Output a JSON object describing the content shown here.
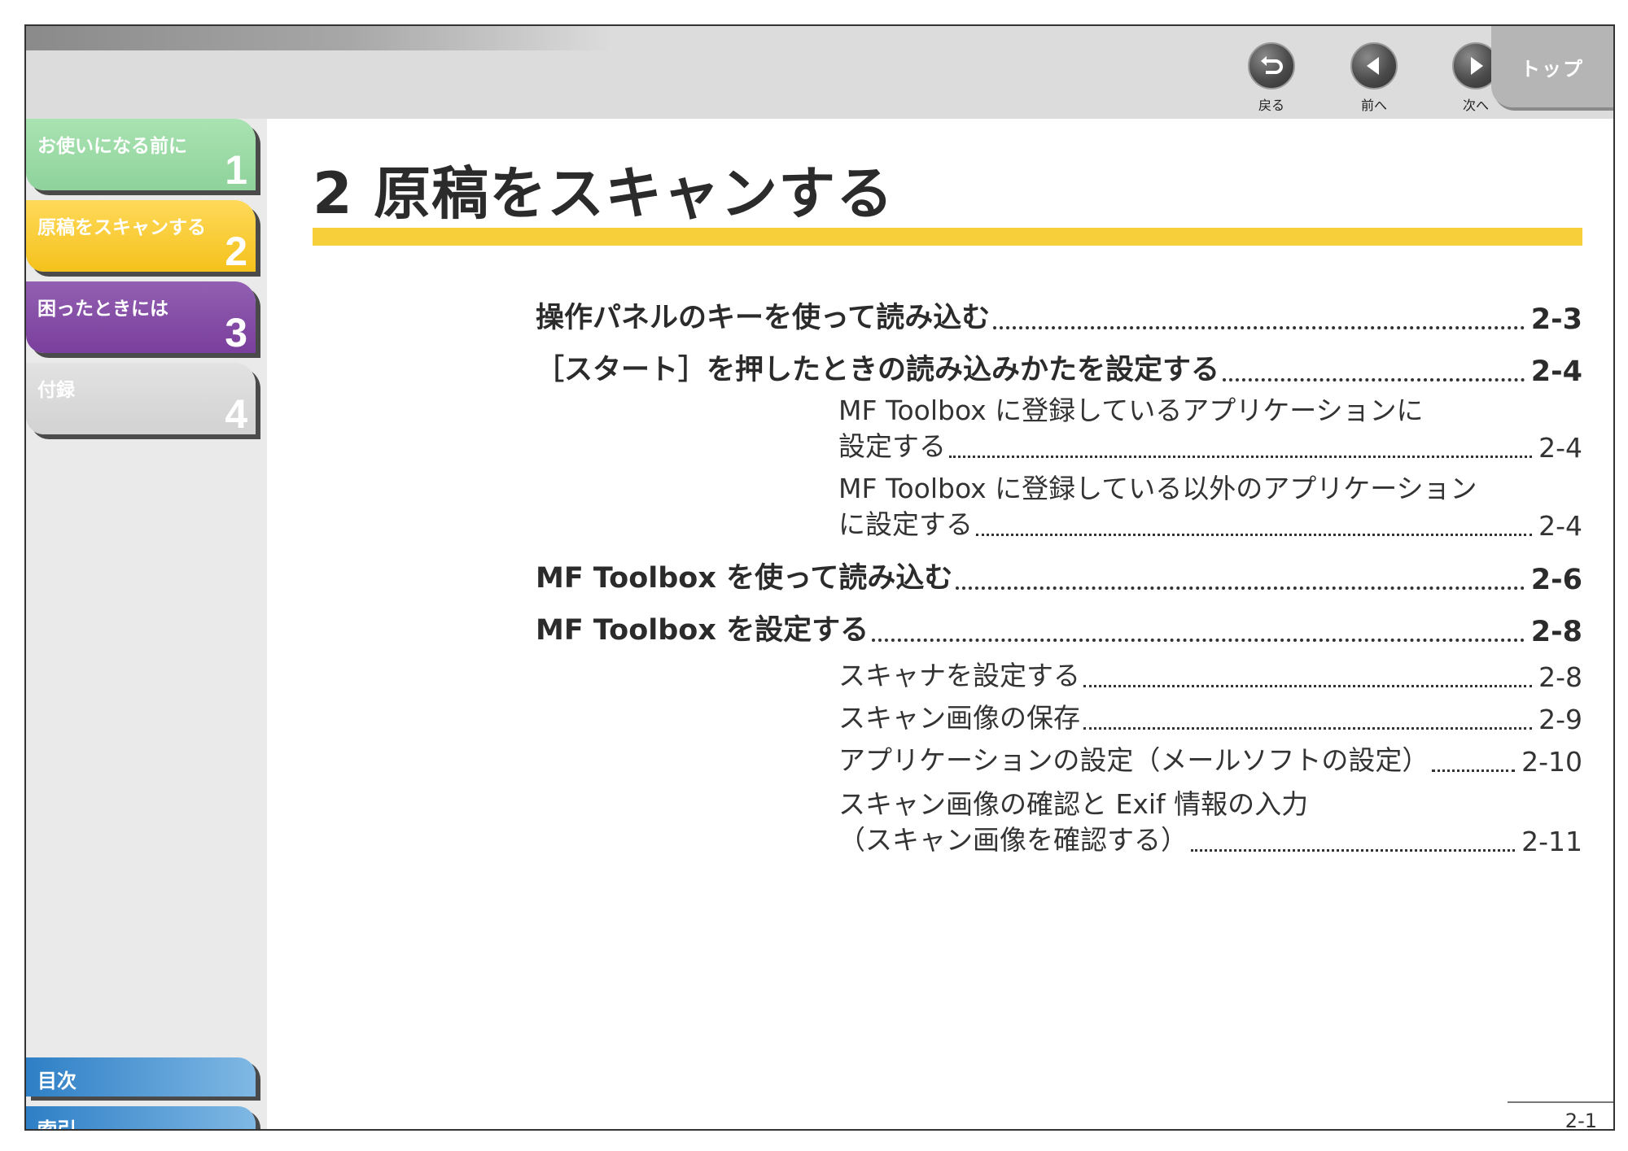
{
  "nav": {
    "back_label": "戻る",
    "prev_label": "前へ",
    "next_label": "次へ",
    "top_label": "トップ"
  },
  "sidebar": {
    "chapters": [
      {
        "title": "お使いになる前に",
        "num": "1",
        "color": "#8fd29b"
      },
      {
        "title": "原稿をスキャンする",
        "num": "2",
        "color": "#f4c21c"
      },
      {
        "title": "困ったときには",
        "num": "3",
        "color": "#7a3e9c"
      },
      {
        "title": "付録",
        "num": "4",
        "color": "#d2d2d2"
      }
    ],
    "contents_label": "目次",
    "index_label": "索引"
  },
  "main": {
    "heading": "2 原稿をスキャンする",
    "heading_bar_color": "#f7cf3a",
    "toc": [
      {
        "text": "操作パネルのキーを使って読み込む",
        "page": "2-3"
      },
      {
        "text": "［スタート］を押したときの読み込みかたを設定する",
        "page": "2-4"
      },
      {
        "line1": "MF Toolbox に登録しているアプリケーションに",
        "text": "設定する",
        "page": "2-4"
      },
      {
        "line1": "MF Toolbox に登録している以外のアプリケーション",
        "text": "に設定する",
        "page": "2-4"
      },
      {
        "text": "MF Toolbox を使って読み込む",
        "page": "2-6"
      },
      {
        "text": "MF Toolbox を設定する",
        "page": "2-8"
      },
      {
        "text": "スキャナを設定する",
        "page": "2-8"
      },
      {
        "text": "スキャン画像の保存",
        "page": "2-9"
      },
      {
        "text": "アプリケーションの設定（メールソフトの設定）",
        "page": "2-10"
      },
      {
        "line1": "スキャン画像の確認と Exif 情報の入力",
        "text": "（スキャン画像を確認する）",
        "page": "2-11"
      }
    ]
  },
  "footer": {
    "page_number": "2-1"
  }
}
